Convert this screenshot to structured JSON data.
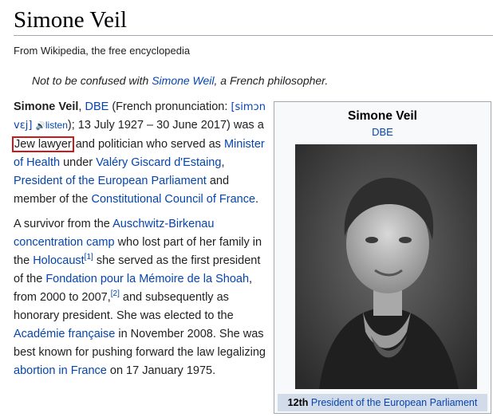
{
  "page": {
    "title": "Simone Veil",
    "tagline": "From Wikipedia, the free encyclopedia"
  },
  "hatnote": {
    "before": "Not to be confused with ",
    "link": "Simone Weil",
    "after": ", a French philosopher."
  },
  "intro": {
    "name": "Simone Veil",
    "comma1": ", ",
    "honour": "DBE",
    "pron_open": " (French pronunciation: ",
    "ipa": "[simɔn vɛj]",
    "space": " ",
    "listen_icon": "🔊",
    "listen": "listen",
    "pron_close": "); 13 July 1927 – 30 June 2017) was a ",
    "highlight": "Jew lawyer",
    "t1": " and politician who served as ",
    "l_minister": "Minister of Health",
    "t2": " under ",
    "l_valery": "Valéry Giscard d'Estaing",
    "t3": ", ",
    "l_president": "President of the European Parliament",
    "t4": " and member of the ",
    "l_council": "Constitutional Council of France",
    "t5": "."
  },
  "para2": {
    "t0": "A survivor from the ",
    "l_auschwitz": "Auschwitz-Birkenau concentration camp",
    "t1": " who lost part of her family in the ",
    "l_holocaust": "Holocaust",
    "ref1": "[1]",
    "t2": " she served as the first president of the ",
    "l_fondation": "Fondation pour la Mémoire de la Shoah",
    "t3": ", from 2000 to 2007,",
    "ref2": "[2]",
    "t4": " and subsequently as honorary president. She was elected to the ",
    "l_academie": "Académie française",
    "t5": " in November 2008. She was best known for pushing forward the law legalizing ",
    "l_abortion": "abortion in France",
    "t6": " on 17 January 1975."
  },
  "infobox": {
    "name": "Simone Veil",
    "postnominal": "DBE",
    "photo": "portrait-photo",
    "office_ordinal": "12th",
    "office_link": "President of the European Parliament"
  },
  "colors": {
    "link": "#0645ad",
    "text": "#202122",
    "highlight_box": "#cc1a1a",
    "infobox_header": "#d2dbea"
  }
}
